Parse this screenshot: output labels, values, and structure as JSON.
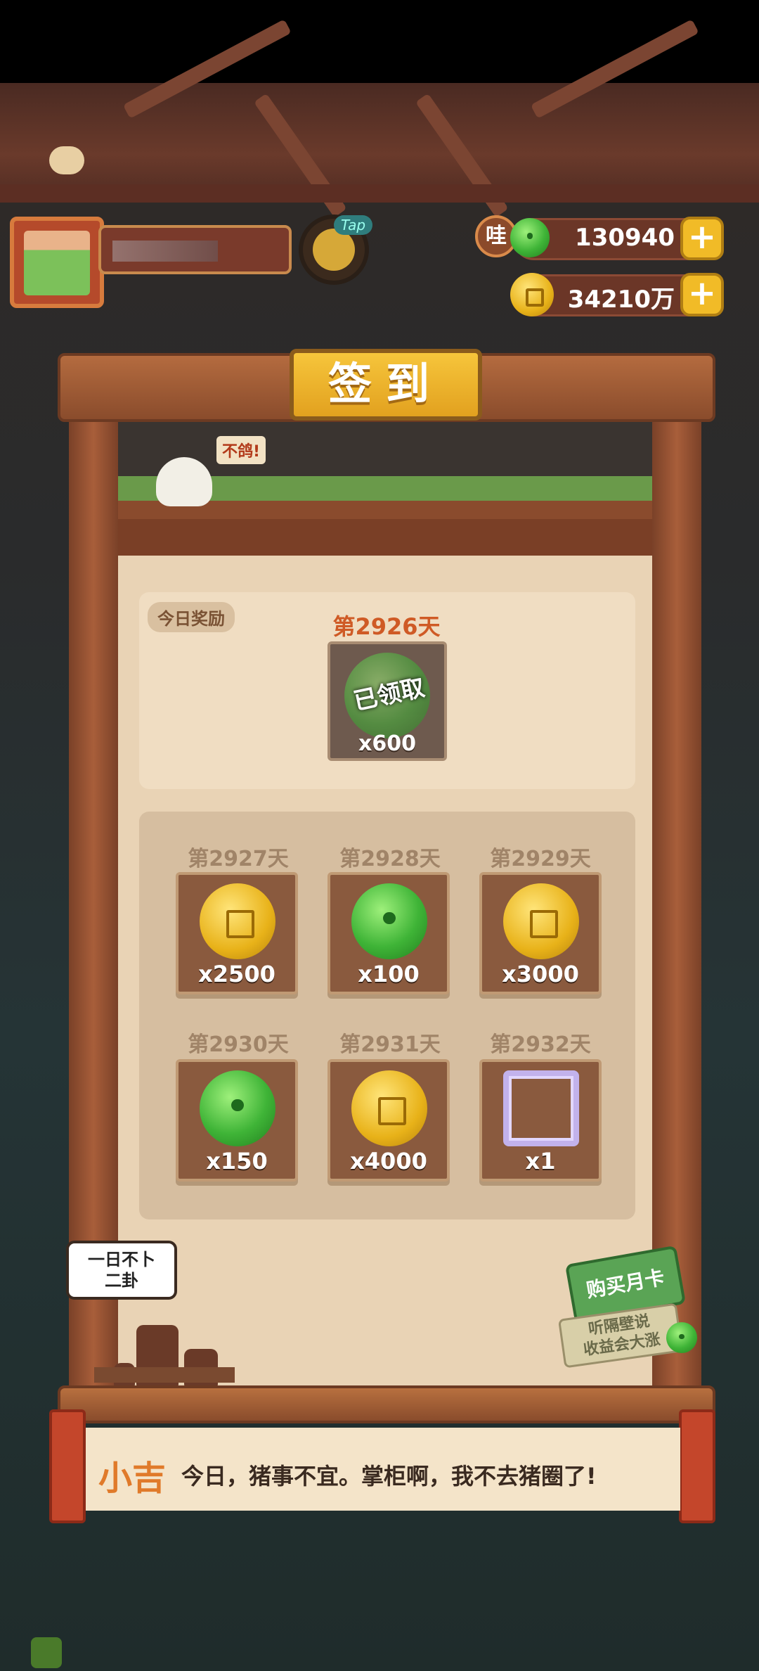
{
  "player": {
    "tap_label": "Tap"
  },
  "resources": {
    "wa_label": "哇",
    "jade_amount": "130940",
    "coin_amount": "34210万",
    "plus_label": "+"
  },
  "signin": {
    "title": "签到",
    "speech": "不鸽!",
    "today": {
      "tag": "今日奖励",
      "day": "第2926天",
      "status": "已领取",
      "qty": "x600",
      "reward_icon": "jade-icon"
    },
    "rewards": [
      {
        "day": "第2927天",
        "qty": "x2500",
        "icon": "coin-icon"
      },
      {
        "day": "第2928天",
        "qty": "x100",
        "icon": "jade-icon"
      },
      {
        "day": "第2929天",
        "qty": "x3000",
        "icon": "coin-icon"
      },
      {
        "day": "第2930天",
        "qty": "x150",
        "icon": "jade-icon"
      },
      {
        "day": "第2931天",
        "qty": "x4000",
        "icon": "coin-icon"
      },
      {
        "day": "第2932天",
        "qty": "x1",
        "icon": "avatar-frame-icon"
      }
    ]
  },
  "bubble": {
    "line1": "一日不卜",
    "line2": "二卦"
  },
  "monthly_card": {
    "label": "购买月卡",
    "note_line1": "听隔壁说",
    "note_line2": "收益会大涨"
  },
  "dialogue": {
    "speaker": "小吉",
    "text": "今日，猪事不宜。掌柜啊，我不去猪圈了!"
  },
  "colors": {
    "accent": "#f1bb27",
    "highlight": "#cf5a25",
    "wood": "#8a4c2c",
    "paper": "#e9d3b5"
  }
}
